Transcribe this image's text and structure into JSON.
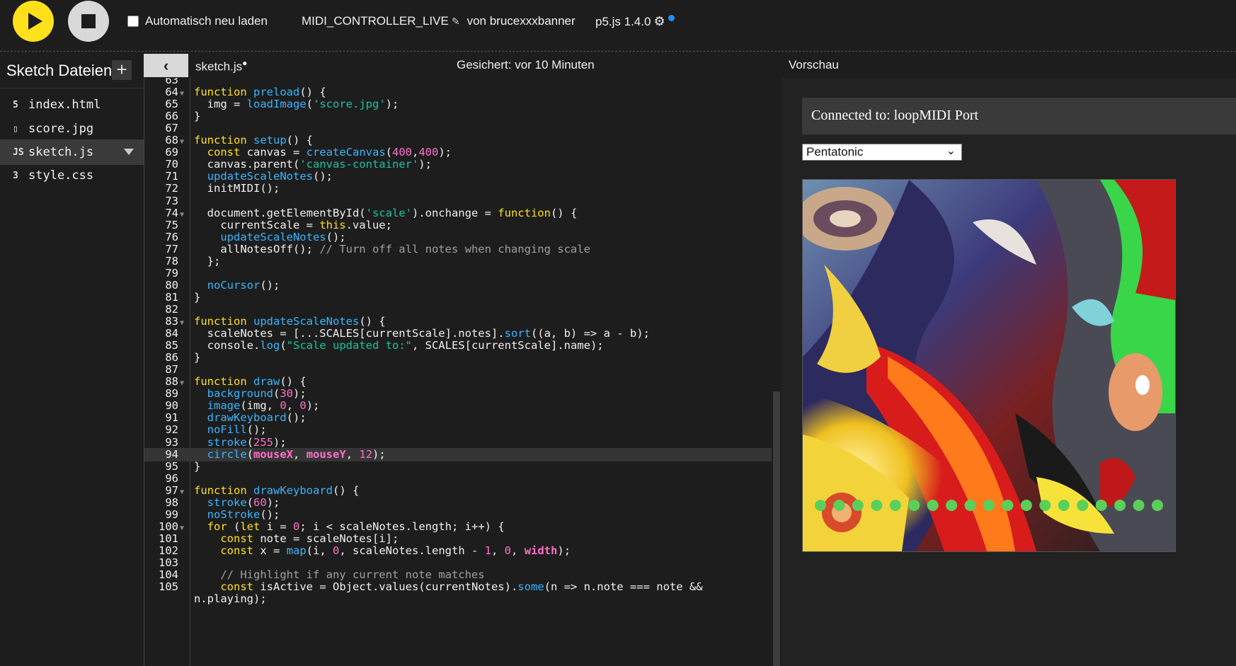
{
  "toolbar": {
    "autoload_label": "Automatisch neu laden",
    "project_name": "MIDI_CONTROLLER_LIVE",
    "author": "von brucexxxbanner",
    "version": "p5.js 1.4.0"
  },
  "sidebar": {
    "title": "Sketch Dateien",
    "files": [
      {
        "name": "index.html",
        "icon": "html-file-icon",
        "glyph": "5"
      },
      {
        "name": "score.jpg",
        "icon": "image-file-icon",
        "glyph": "▯"
      },
      {
        "name": "sketch.js",
        "icon": "js-file-icon",
        "glyph": "JS",
        "active": true
      },
      {
        "name": "style.css",
        "icon": "css-file-icon",
        "glyph": "3"
      }
    ]
  },
  "editor": {
    "tab": "sketch.js",
    "unsaved_marker": "●",
    "saved_status": "Gesichert: vor 10 Minuten",
    "highlight_line": 94,
    "fold_lines": [
      64,
      68,
      74,
      83,
      88,
      97,
      100
    ],
    "lines": [
      {
        "n": 63,
        "t": ""
      },
      {
        "n": 64,
        "t": "function preload() {"
      },
      {
        "n": 65,
        "t": "  img = loadImage('score.jpg');"
      },
      {
        "n": 66,
        "t": "}"
      },
      {
        "n": 67,
        "t": ""
      },
      {
        "n": 68,
        "t": "function setup() {"
      },
      {
        "n": 69,
        "t": "  const canvas = createCanvas(400,400);"
      },
      {
        "n": 70,
        "t": "  canvas.parent('canvas-container');"
      },
      {
        "n": 71,
        "t": "  updateScaleNotes();"
      },
      {
        "n": 72,
        "t": "  initMIDI();"
      },
      {
        "n": 73,
        "t": ""
      },
      {
        "n": 74,
        "t": "  document.getElementById('scale').onchange = function() {"
      },
      {
        "n": 75,
        "t": "    currentScale = this.value;"
      },
      {
        "n": 76,
        "t": "    updateScaleNotes();"
      },
      {
        "n": 77,
        "t": "    allNotesOff(); // Turn off all notes when changing scale"
      },
      {
        "n": 78,
        "t": "  };"
      },
      {
        "n": 79,
        "t": ""
      },
      {
        "n": 80,
        "t": "  noCursor();"
      },
      {
        "n": 81,
        "t": "}"
      },
      {
        "n": 82,
        "t": ""
      },
      {
        "n": 83,
        "t": "function updateScaleNotes() {"
      },
      {
        "n": 84,
        "t": "  scaleNotes = [...SCALES[currentScale].notes].sort((a, b) => a - b);"
      },
      {
        "n": 85,
        "t": "  console.log(\"Scale updated to:\", SCALES[currentScale].name);"
      },
      {
        "n": 86,
        "t": "}"
      },
      {
        "n": 87,
        "t": ""
      },
      {
        "n": 88,
        "t": "function draw() {"
      },
      {
        "n": 89,
        "t": "  background(30);"
      },
      {
        "n": 90,
        "t": "  image(img, 0, 0);"
      },
      {
        "n": 91,
        "t": "  drawKeyboard();"
      },
      {
        "n": 92,
        "t": "  noFill();"
      },
      {
        "n": 93,
        "t": "  stroke(255);"
      },
      {
        "n": 94,
        "t": "  circle(mouseX, mouseY, 12);"
      },
      {
        "n": 95,
        "t": "}"
      },
      {
        "n": 96,
        "t": ""
      },
      {
        "n": 97,
        "t": "function drawKeyboard() {"
      },
      {
        "n": 98,
        "t": "  stroke(60);"
      },
      {
        "n": 99,
        "t": "  noStroke();"
      },
      {
        "n": 100,
        "t": "  for (let i = 0; i < scaleNotes.length; i++) {"
      },
      {
        "n": 101,
        "t": "    const note = scaleNotes[i];"
      },
      {
        "n": 102,
        "t": "    const x = map(i, 0, scaleNotes.length - 1, 0, width);"
      },
      {
        "n": 103,
        "t": ""
      },
      {
        "n": 104,
        "t": "    // Highlight if any current note matches"
      },
      {
        "n": 105,
        "t": "    const isActive = Object.values(currentNotes).some(n => n.note === note &&"
      },
      {
        "n": null,
        "t": "n.playing);"
      }
    ]
  },
  "preview": {
    "label": "Vorschau",
    "midi_status": "Connected to: loopMIDI Port",
    "scale_select": "Pentatonic",
    "keyboard_dot_count": 19,
    "colors": {
      "accent_yellow": "#ffe11b",
      "dot_green": "#5ad05a"
    }
  }
}
